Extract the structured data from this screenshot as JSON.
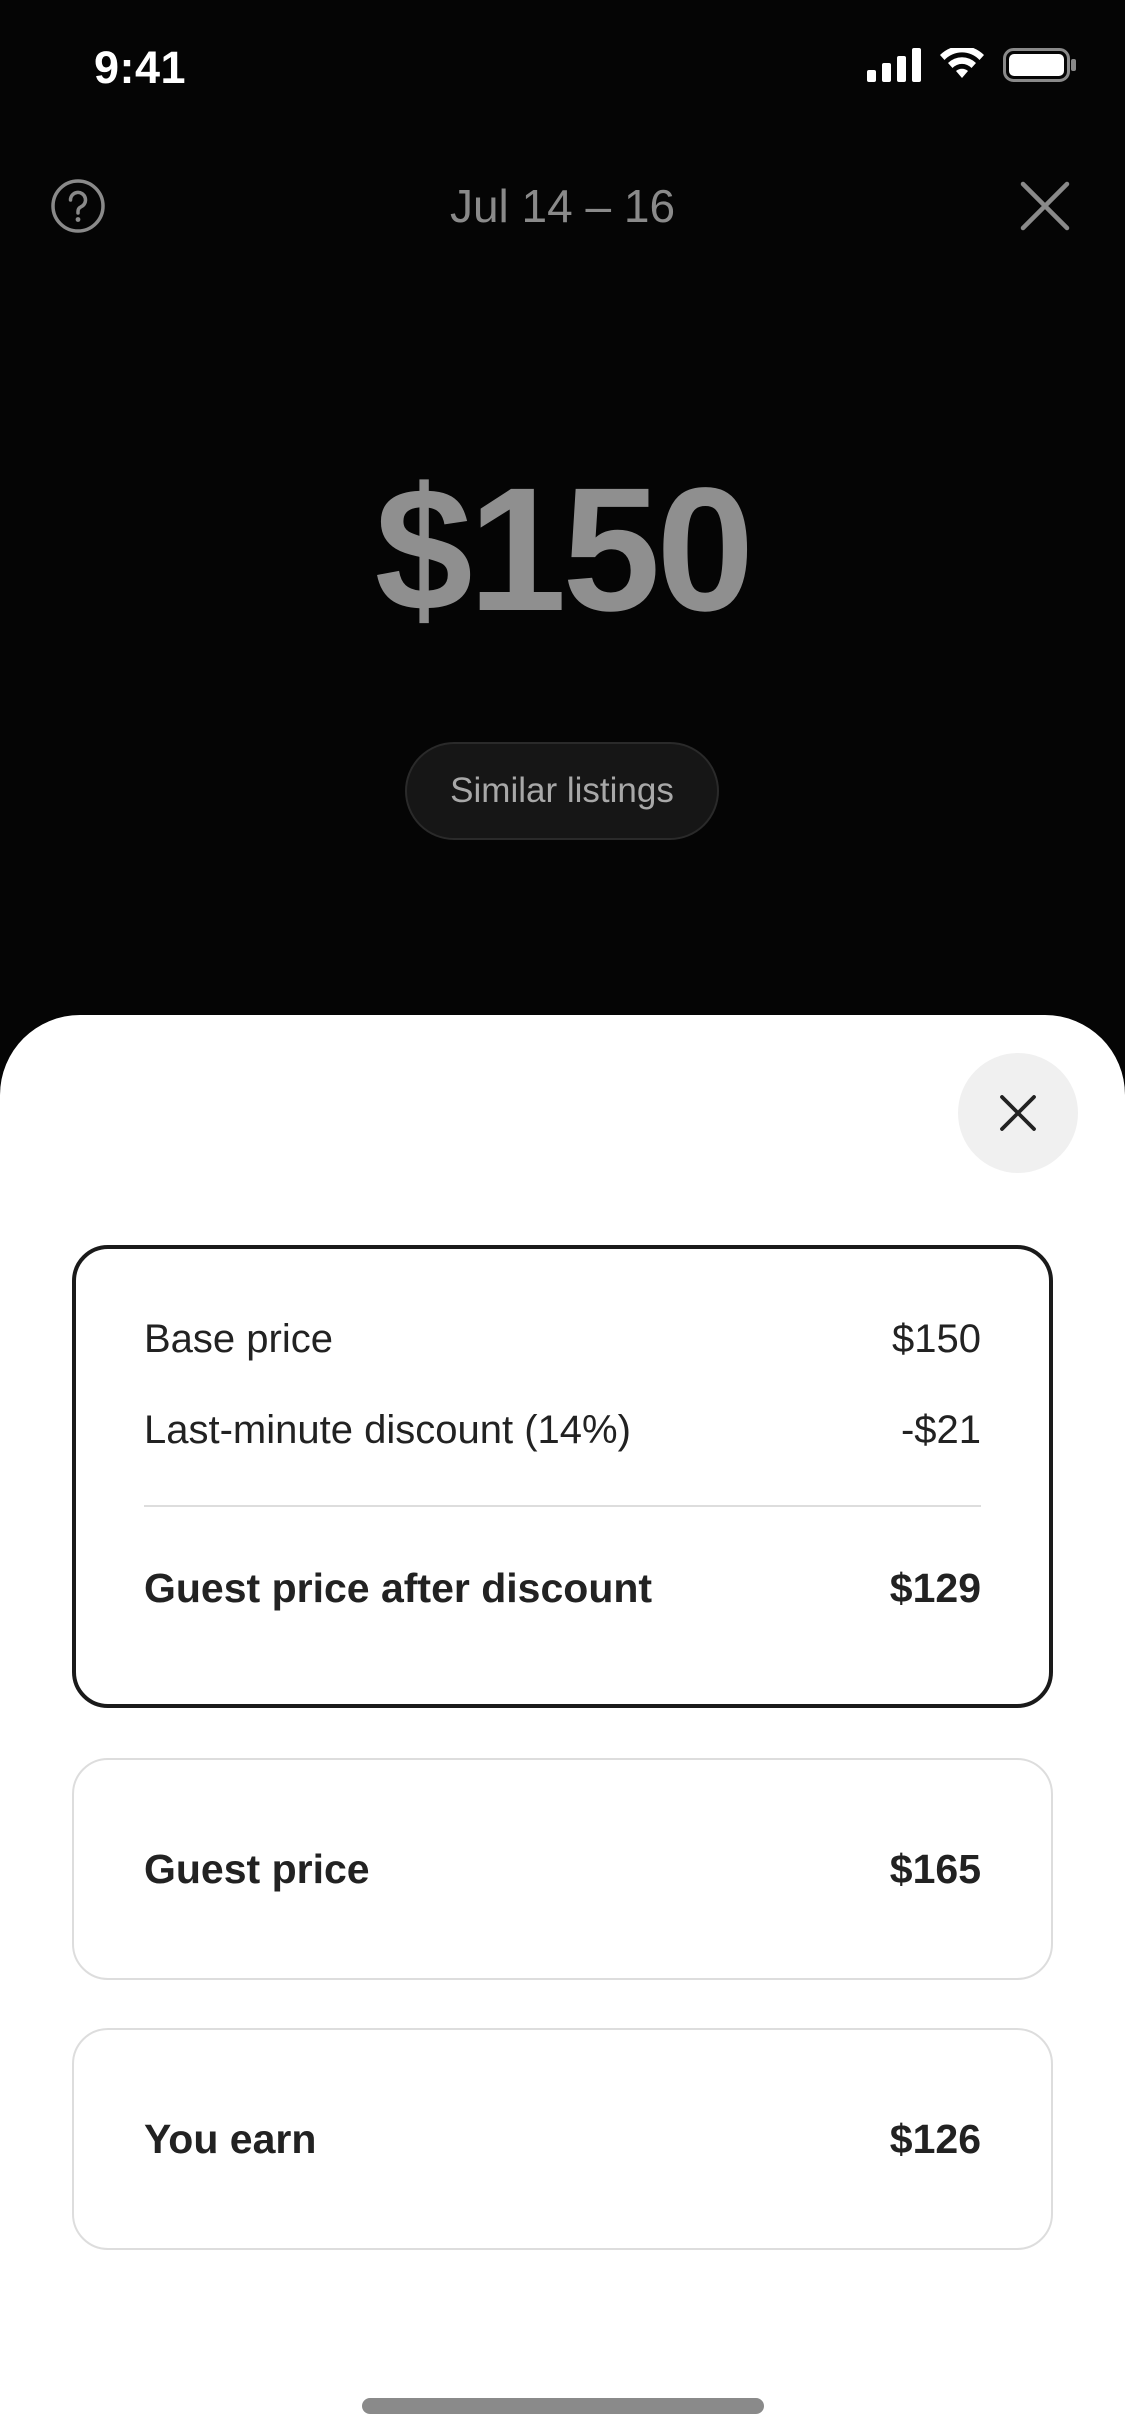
{
  "status_bar": {
    "time": "9:41"
  },
  "header": {
    "date_range": "Jul 14 – 16",
    "help_icon": "question-circle-icon",
    "close_icon": "close-icon"
  },
  "price": {
    "amount": "$150"
  },
  "similar_listings": {
    "label": "Similar listings"
  },
  "breakdown": {
    "rows": [
      {
        "label": "Base price",
        "value": "$150"
      },
      {
        "label": "Last-minute discount (14%)",
        "value": "-$21"
      }
    ],
    "total": {
      "label": "Guest price after discount",
      "value": "$129"
    }
  },
  "guest_price": {
    "label": "Guest price",
    "value": "$165"
  },
  "you_earn": {
    "label": "You earn",
    "value": "$126"
  },
  "colors": {
    "background": "#050505",
    "sheet": "#ffffff",
    "text_primary": "#222222",
    "text_muted": "#8f8f8f"
  }
}
